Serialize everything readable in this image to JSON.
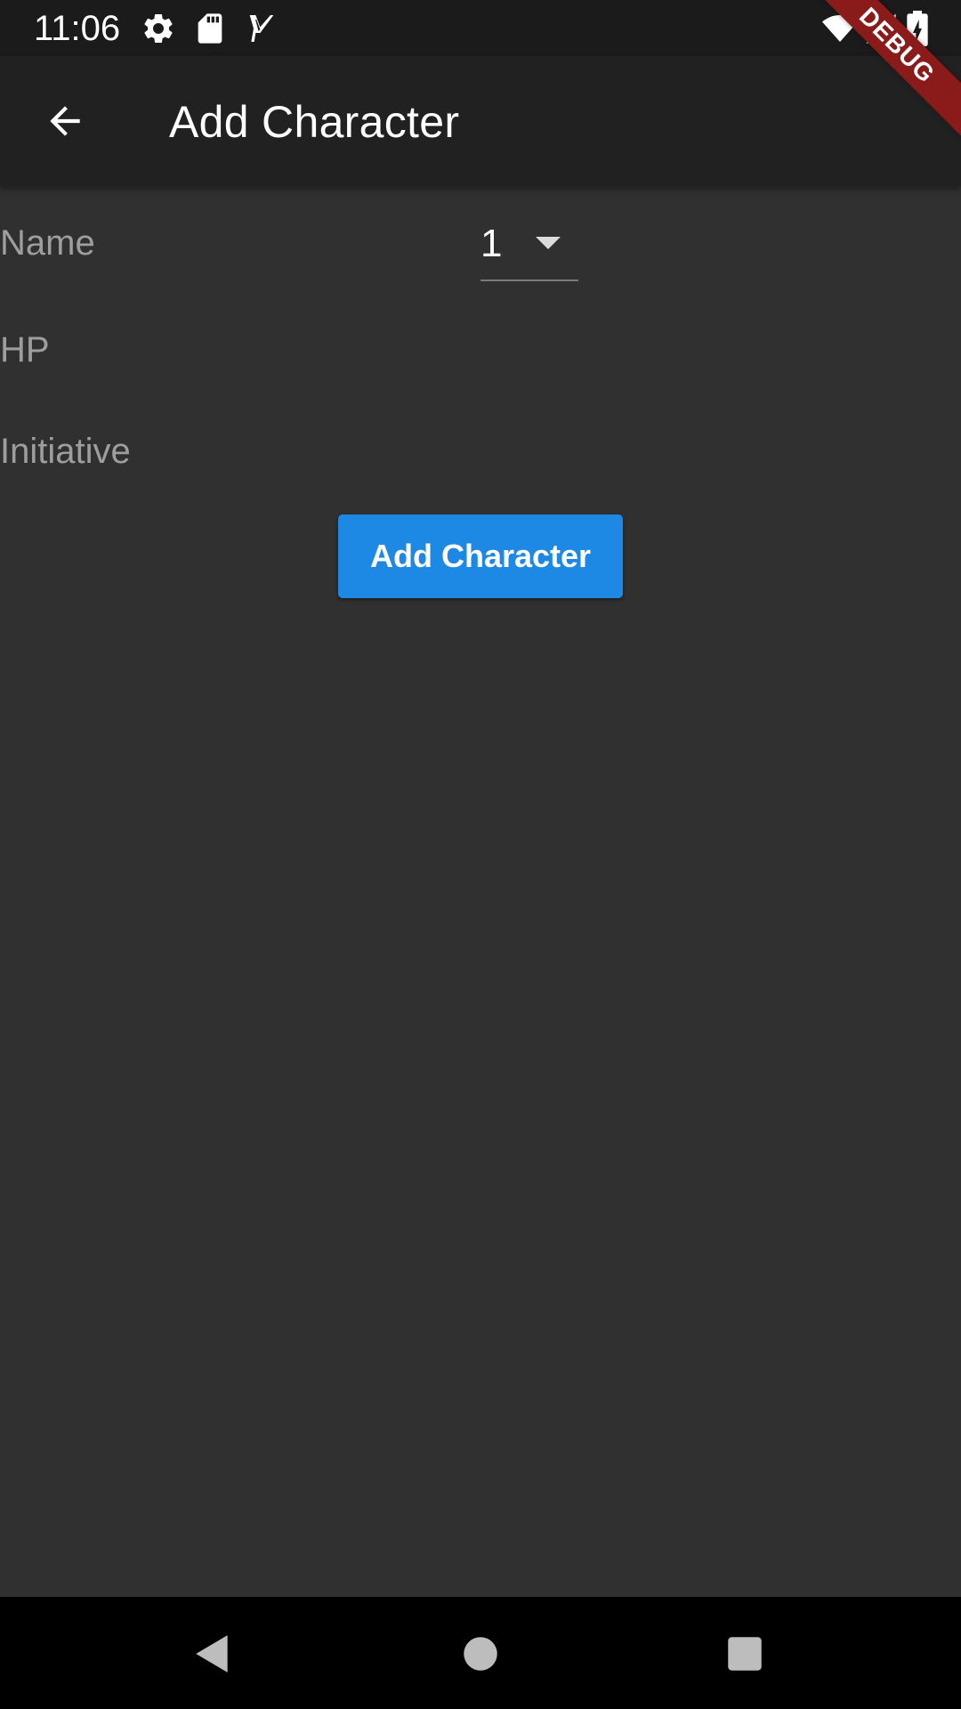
{
  "status_bar": {
    "time": "11:06",
    "icons": [
      "gear-icon",
      "sd-card-icon",
      "task-check-icon",
      "wifi-icon",
      "cellular-signal-icon",
      "battery-charging-icon"
    ]
  },
  "app_bar": {
    "title": "Add Character",
    "back_icon": "arrow-back-icon"
  },
  "debug_banner": "DEBUG",
  "form": {
    "name_label": "Name",
    "hp_label": "HP",
    "initiative_label": "Initiative",
    "dropdown_value": "1",
    "submit_label": "Add Character"
  },
  "nav_bar": {
    "icons": [
      "nav-back-icon",
      "nav-home-icon",
      "nav-recents-icon"
    ]
  },
  "colors": {
    "background": "#303030",
    "app_bar": "#212121",
    "status_bar": "#1b1b1b",
    "accent": "#1e88e5",
    "label": "#9e9e9e",
    "debug_ribbon": "#8b1a1a"
  }
}
